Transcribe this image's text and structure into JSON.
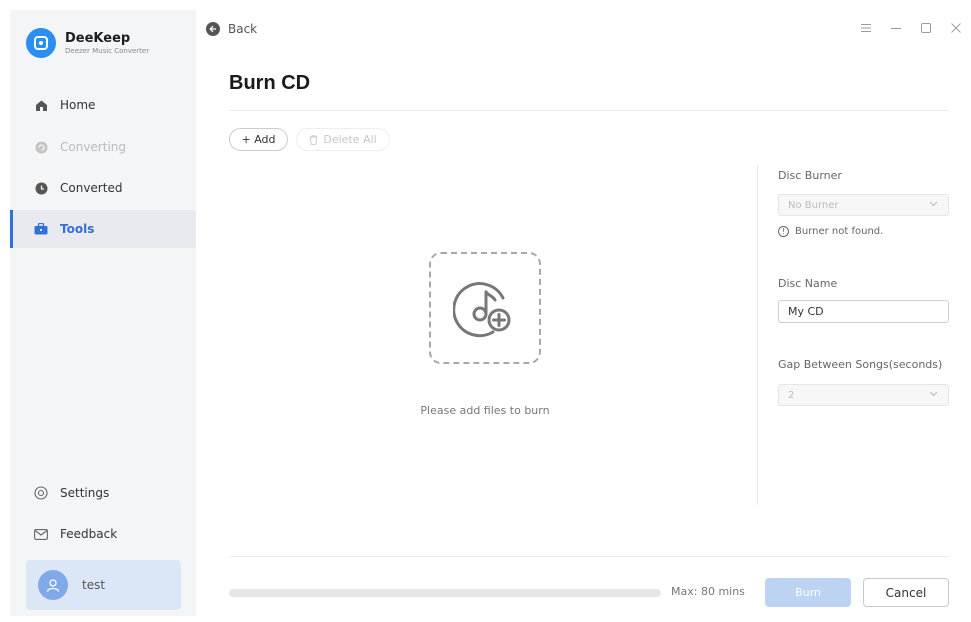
{
  "brand": {
    "name": "DeeKeep",
    "subtitle": "Deezer Music Converter"
  },
  "sidebar": {
    "items": [
      {
        "label": "Home",
        "icon": "home-icon",
        "state": "normal"
      },
      {
        "label": "Converting",
        "icon": "converting-icon",
        "state": "disabled"
      },
      {
        "label": "Converted",
        "icon": "clock-icon",
        "state": "normal"
      },
      {
        "label": "Tools",
        "icon": "toolbox-icon",
        "state": "active"
      }
    ],
    "bottom_items": [
      {
        "label": "Settings",
        "icon": "gear-icon"
      },
      {
        "label": "Feedback",
        "icon": "mail-icon"
      }
    ],
    "user": {
      "name": "test"
    }
  },
  "topbar": {
    "back_label": "Back"
  },
  "page": {
    "title": "Burn CD",
    "add_label": "+ Add",
    "delete_all_label": "Delete All",
    "drop_hint": "Please add files to burn"
  },
  "panel": {
    "disc_burner_label": "Disc Burner",
    "disc_burner_value": "No Burner",
    "burner_note": "Burner not found.",
    "disc_name_label": "Disc Name",
    "disc_name_value": "My CD",
    "gap_label": "Gap Between Songs(seconds)",
    "gap_value": "2"
  },
  "footer": {
    "progress_fraction": 0,
    "max_label": "Max: 80 mins",
    "burn_label": "Burn",
    "cancel_label": "Cancel"
  },
  "colors": {
    "accent": "#2f71d8",
    "sidebar_bg": "#f4f5f7",
    "user_card_bg": "#dbe7f7",
    "burn_disabled": "#bcd3f2"
  }
}
